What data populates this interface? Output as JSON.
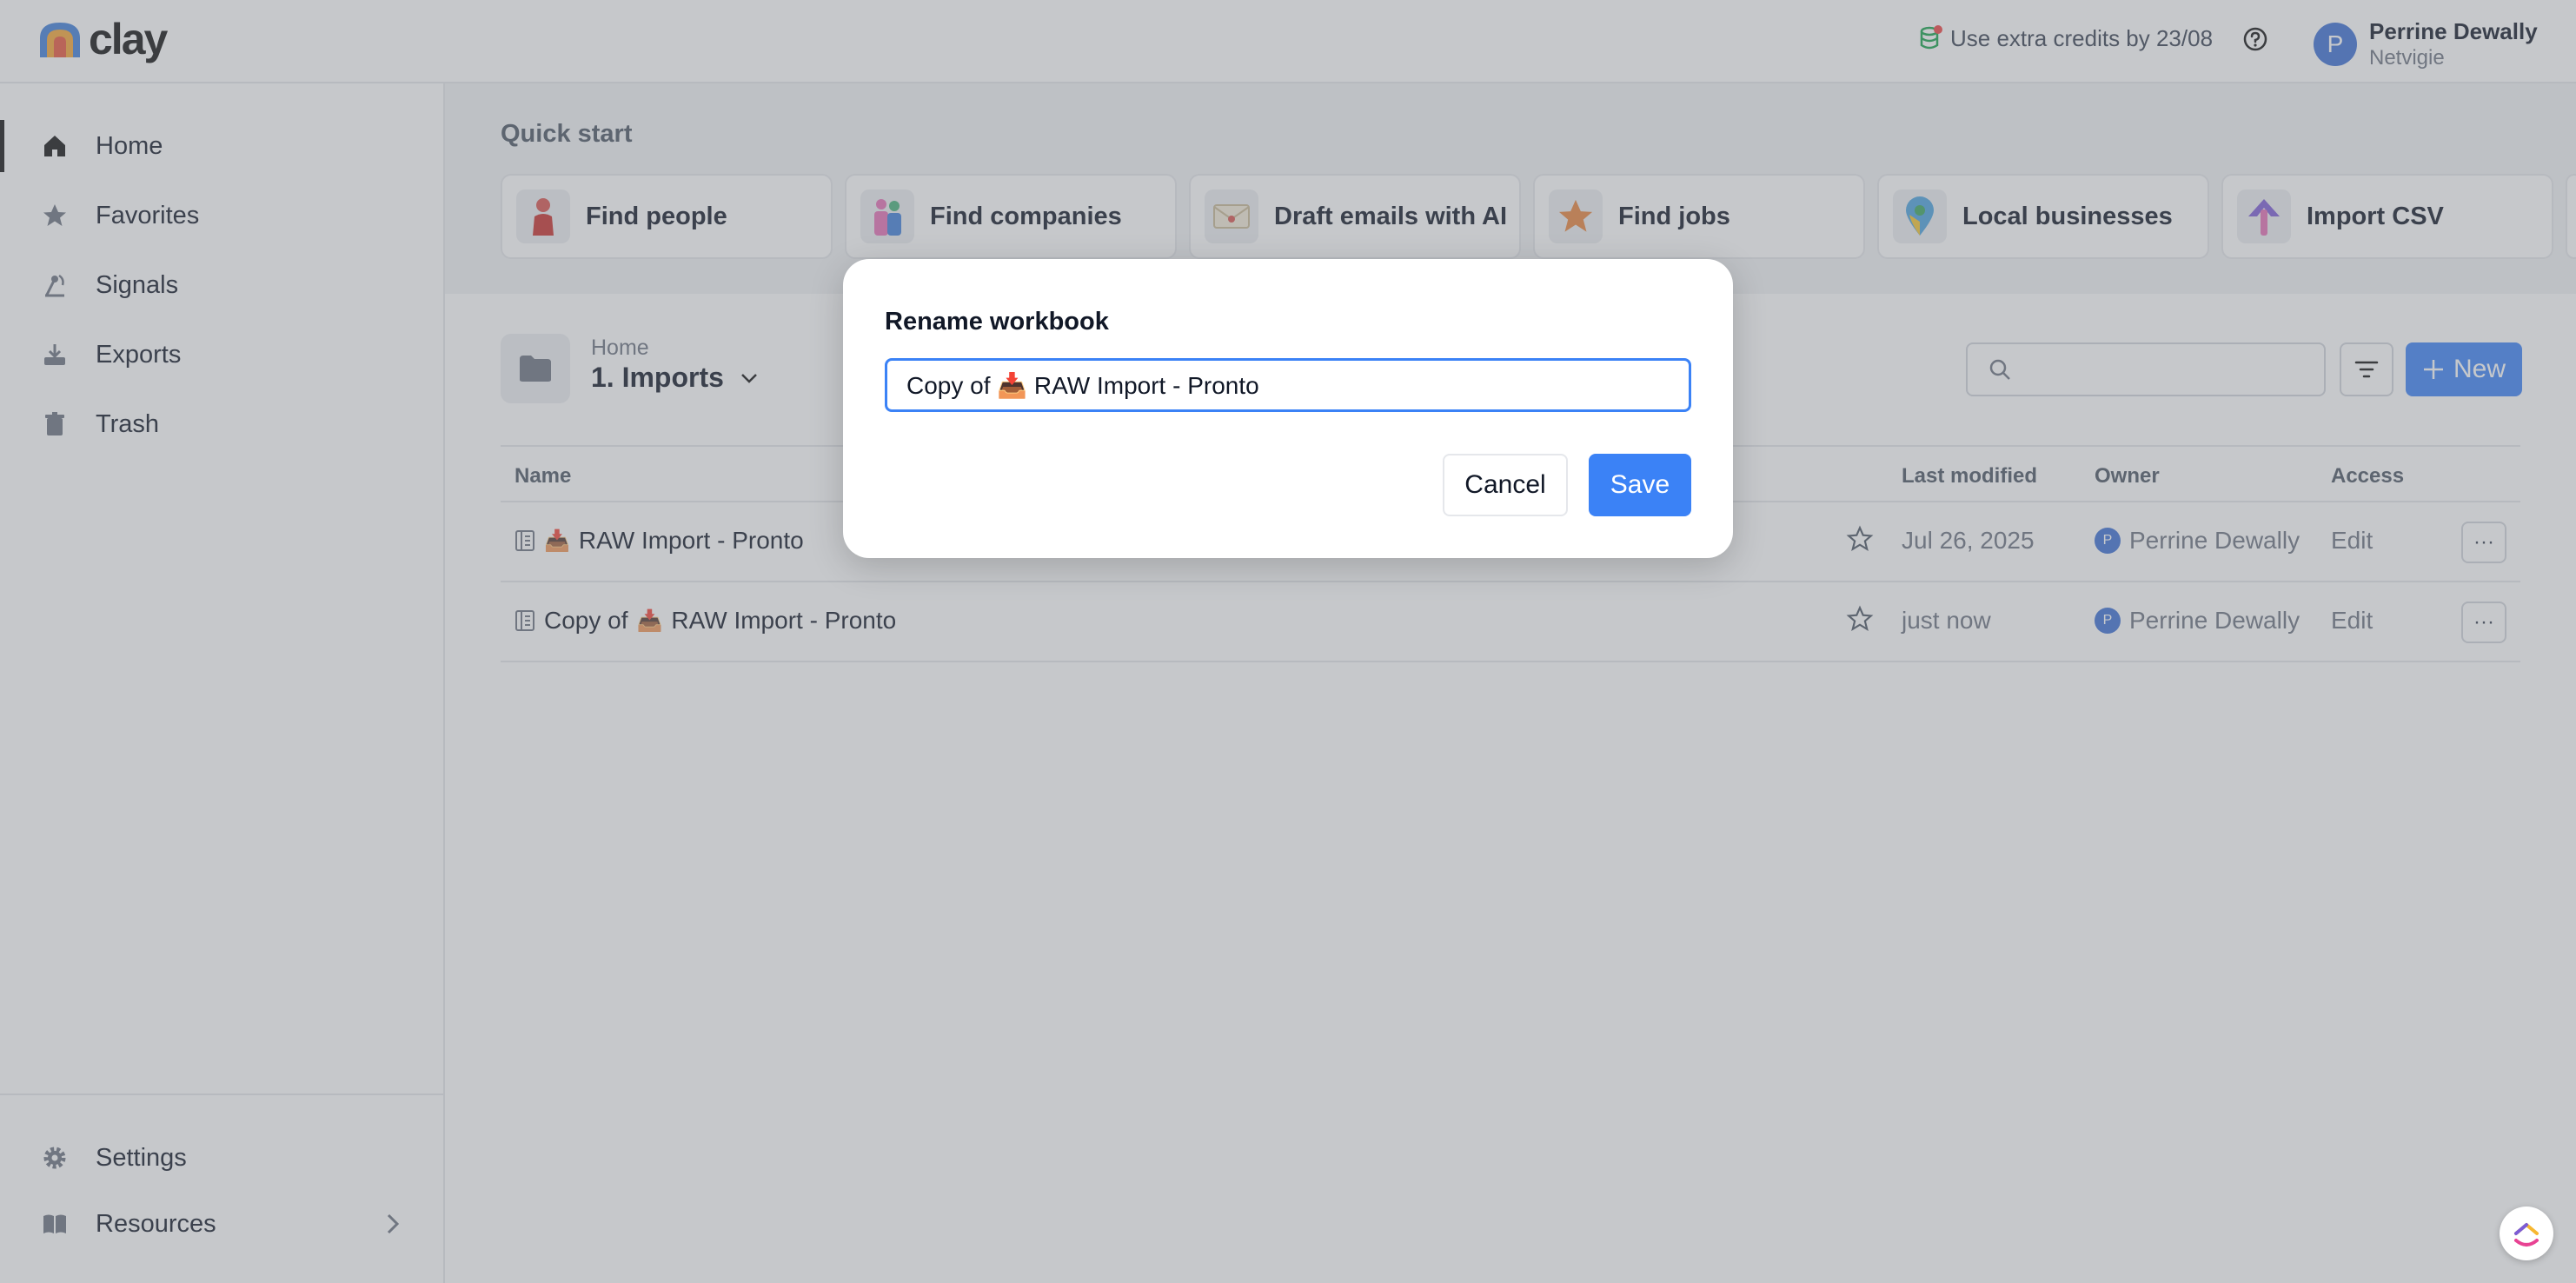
{
  "app": {
    "logo_text": "clay"
  },
  "topbar": {
    "credits_text": "Use extra credits by 23/08",
    "user": {
      "avatar_letter": "P",
      "name": "Perrine Dewally",
      "org": "Netvigie"
    }
  },
  "sidebar": {
    "items": [
      {
        "label": "Home",
        "icon": "home-icon"
      },
      {
        "label": "Favorites",
        "icon": "star-icon"
      },
      {
        "label": "Signals",
        "icon": "signal-icon"
      },
      {
        "label": "Exports",
        "icon": "export-icon"
      },
      {
        "label": "Trash",
        "icon": "trash-icon"
      }
    ],
    "bottom": [
      {
        "label": "Settings",
        "icon": "gear-icon"
      },
      {
        "label": "Resources",
        "icon": "book-icon"
      }
    ]
  },
  "quick_start": {
    "title": "Quick start",
    "cards": [
      {
        "label": "Find people",
        "icon": "person-icon"
      },
      {
        "label": "Find companies",
        "icon": "people-icon"
      },
      {
        "label": "Draft emails with AI",
        "icon": "envelope-icon"
      },
      {
        "label": "Find jobs",
        "icon": "star-icon"
      },
      {
        "label": "Local businesses",
        "icon": "map-pin-icon"
      },
      {
        "label": "Import CSV",
        "icon": "arrow-up-icon"
      }
    ]
  },
  "folder": {
    "breadcrumb": "Home",
    "title": "1. Imports"
  },
  "toolbar": {
    "new_label": "New"
  },
  "table": {
    "headers": {
      "name": "Name",
      "last_modified": "Last modified",
      "owner": "Owner",
      "access": "Access"
    },
    "rows": [
      {
        "emoji": "📥",
        "name": "RAW Import - Pronto",
        "last_modified": "Jul 26, 2025",
        "owner_initial": "P",
        "owner": "Perrine Dewally",
        "access": "Edit",
        "more": "···"
      },
      {
        "prefix": "Copy of",
        "emoji": "📥",
        "name": "RAW Import - Pronto",
        "last_modified": "just now",
        "owner_initial": "P",
        "owner": "Perrine Dewally",
        "access": "Edit",
        "more": "···"
      }
    ]
  },
  "modal": {
    "title": "Rename workbook",
    "input_value": "Copy of 📥 RAW Import - Pronto",
    "cancel_label": "Cancel",
    "save_label": "Save"
  },
  "colors": {
    "accent": "#3b82f6",
    "avatar": "#3b6fd4"
  }
}
